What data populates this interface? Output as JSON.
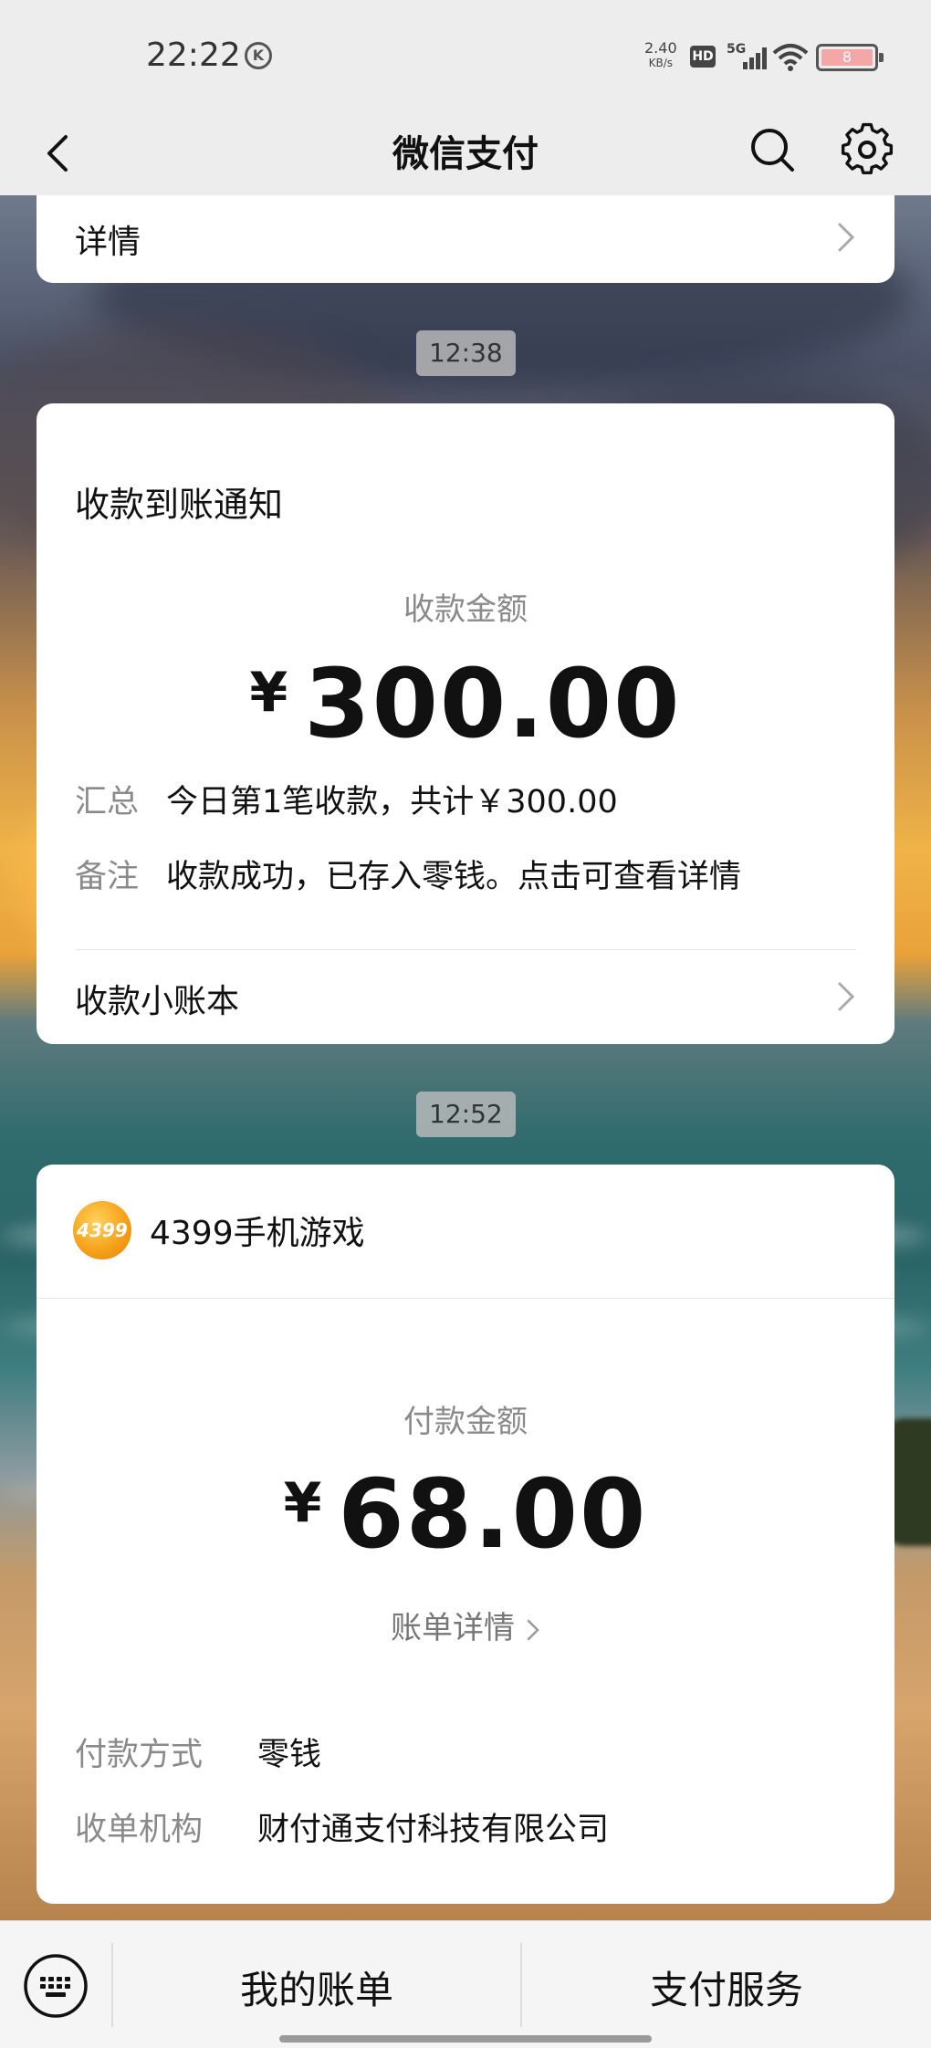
{
  "status_bar": {
    "time": "22:22",
    "network_speed": "2.40",
    "network_speed_unit": "KB/s",
    "hd_label": "HD",
    "signal_label": "5G",
    "battery": "8"
  },
  "nav": {
    "title": "微信支付"
  },
  "previous_card": {
    "label": "详情"
  },
  "messages": [
    {
      "time": "12:38",
      "title": "收款到账通知",
      "amount_label": "收款金额",
      "currency": "¥",
      "amount": "300.00",
      "summary_key": "汇总",
      "summary_value": "今日第1笔收款，共计￥300.00",
      "note_key": "备注",
      "note_value": "收款成功，已存入零钱。点击可查看详情",
      "ledger_label": "收款小账本"
    },
    {
      "time": "12:52",
      "merchant_logo_text": "4399",
      "merchant": "4399手机游戏",
      "amount_label": "付款金额",
      "currency": "¥",
      "amount": "68.00",
      "bill_details": "账单详情",
      "method_key": "付款方式",
      "method_value": "零钱",
      "acquirer_key": "收单机构",
      "acquirer_value": "财付通支付科技有限公司"
    }
  ],
  "bottom_bar": {
    "my_bills": "我的账单",
    "payment_services": "支付服务"
  }
}
